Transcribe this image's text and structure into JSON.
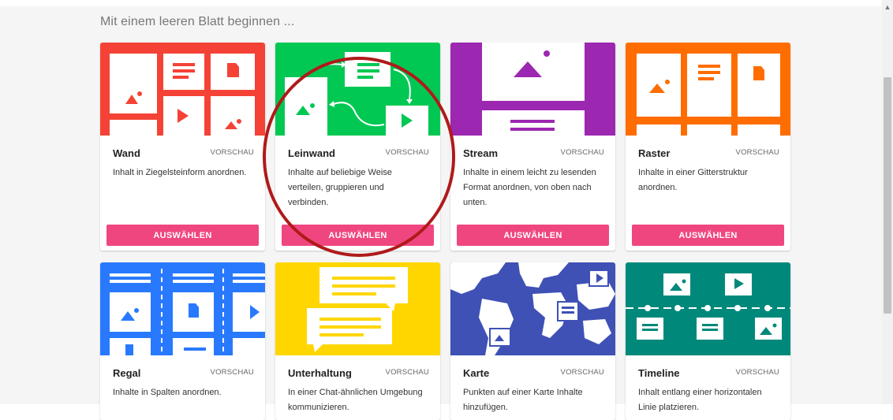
{
  "section_heading": "Mit einem leeren Blatt beginnen ...",
  "preview_label": "VORSCHAU",
  "select_label": "AUSWÄHLEN",
  "cards": [
    {
      "title": "Wand",
      "description": "Inhalt in Ziegelsteinform anordnen.",
      "color": "#f44336",
      "icon": "wall-layout-icon"
    },
    {
      "title": "Leinwand",
      "description": "Inhalte auf beliebige Weise verteilen, gruppieren und verbinden.",
      "color": "#00c853",
      "icon": "canvas-layout-icon"
    },
    {
      "title": "Stream",
      "description": "Inhalte in einem leicht zu lesenden Format anordnen, von oben nach unten.",
      "color": "#9c27b0",
      "icon": "stream-layout-icon"
    },
    {
      "title": "Raster",
      "description": "Inhalte in einer Gitterstruktur anordnen.",
      "color": "#ff6d00",
      "icon": "grid-layout-icon"
    },
    {
      "title": "Regal",
      "description": "Inhalte in Spalten anordnen.",
      "color": "#2979ff",
      "icon": "shelf-layout-icon"
    },
    {
      "title": "Unterhaltung",
      "description": "In einer Chat-ähnlichen Umgebung kommunizieren.",
      "color": "#ffd600",
      "icon": "chat-layout-icon"
    },
    {
      "title": "Karte",
      "description": "Punkten auf einer Karte Inhalte hinzufügen.",
      "color": "#3f51b5",
      "icon": "map-layout-icon"
    },
    {
      "title": "Timeline",
      "description": "Inhalt entlang einer horizontalen Linie platzieren.",
      "color": "#00897b",
      "icon": "timeline-layout-icon"
    }
  ]
}
